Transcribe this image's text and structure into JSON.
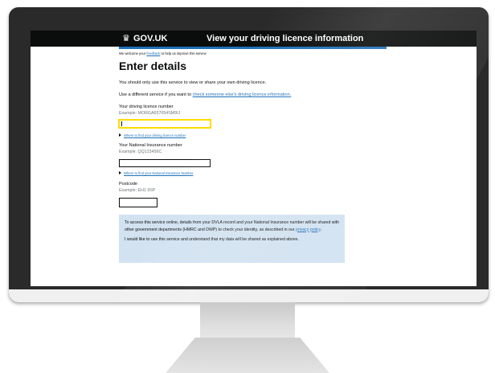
{
  "header": {
    "logo_text": "GOV.UK",
    "service_name": "View your driving licence information",
    "crown_icon": "crown-icon",
    "bg_color": "#0b0c0c",
    "underline_color": "#1d70b8"
  },
  "feedback": {
    "prefix": "We welcome your ",
    "link": "feedback",
    "suffix": " to help us improve this service"
  },
  "page": {
    "title": "Enter details",
    "intro": "You should only use this service to view or share your own driving licence.",
    "other_service_prefix": "Use a different service if you want to ",
    "other_service_link": "check someone else's driving licence information."
  },
  "fields": {
    "licence": {
      "label": "Your driving licence number",
      "hint": "Example: MORGA657054SM9IJ",
      "value": "",
      "help_link": "Where to find your driving licence number"
    },
    "ni": {
      "label": "Your National Insurance number",
      "hint": "Example: QQ123456C",
      "value": "",
      "help_link": "Where to find your National Insurance Number"
    },
    "postcode": {
      "label": "Postcode",
      "hint": "Example: EH1 9SP",
      "value": ""
    }
  },
  "consent": {
    "text_prefix": "To access this service online, details from your DVLA record and your National Insurance number will be shared with other government departments (HMRC and DWP) to check your identity, as described in our ",
    "privacy_link": "privacy policy",
    "text_suffix": ".",
    "agree": "I would like to use this service and understand that my data will be shared as explained above.",
    "bg_color": "#d2e2f1"
  },
  "colors": {
    "link": "#1d70b8",
    "focus": "#ffdd00",
    "text": "#0b0c0c"
  }
}
